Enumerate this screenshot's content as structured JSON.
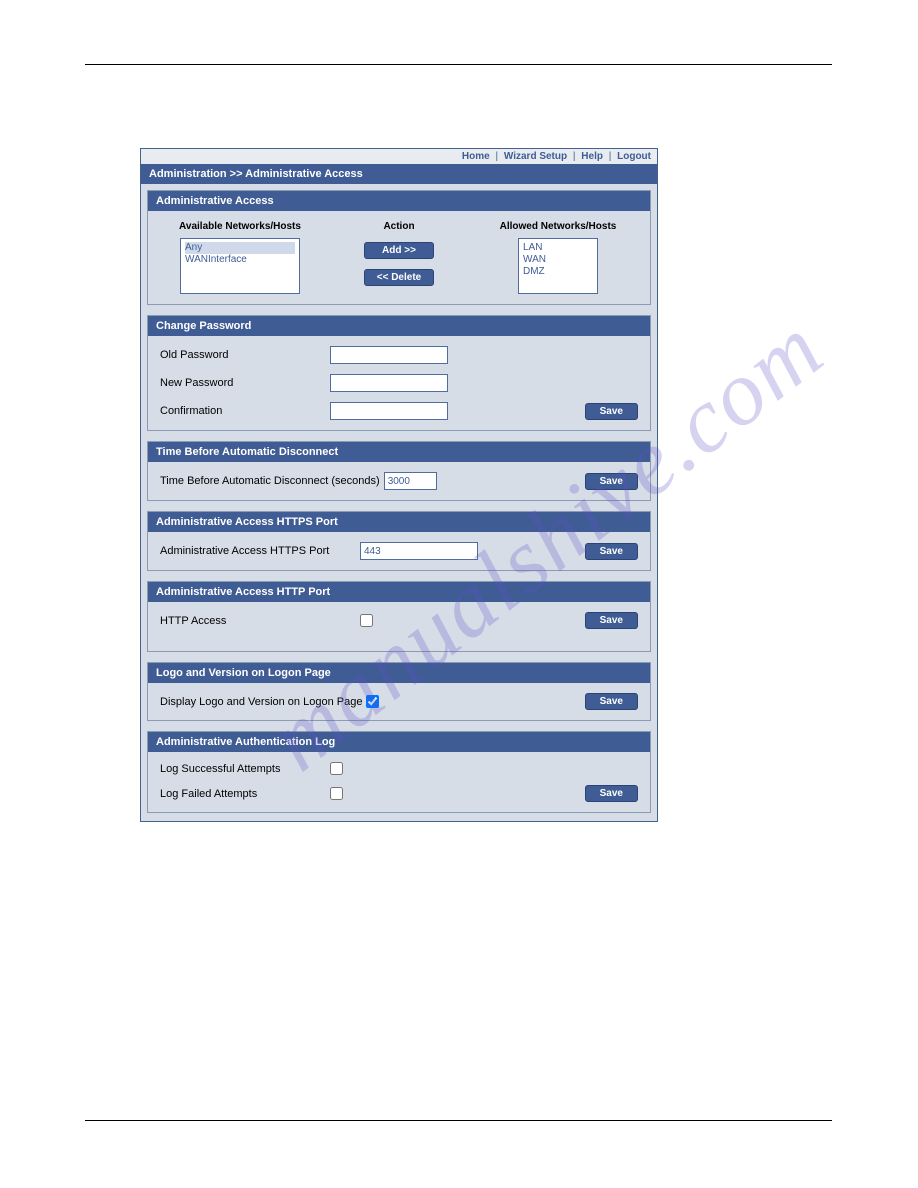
{
  "topnav": {
    "home": "Home",
    "wizard": "Wizard Setup",
    "help": "Help",
    "logout": "Logout",
    "sep": "|"
  },
  "breadcrumb": "Administration >> Administrative Access",
  "panel_admin_access": {
    "title": "Administrative Access",
    "col_available": "Available Networks/Hosts",
    "col_action": "Action",
    "col_allowed": "Allowed Networks/Hosts",
    "available": [
      "Any",
      "WANInterface"
    ],
    "allowed": [
      "LAN",
      "WAN",
      "DMZ"
    ],
    "btn_add": "Add  >>",
    "btn_delete": "<<  Delete"
  },
  "panel_password": {
    "title": "Change Password",
    "old": "Old Password",
    "newp": "New Password",
    "confirm": "Confirmation",
    "save": "Save"
  },
  "panel_timeout": {
    "title": "Time Before Automatic Disconnect",
    "label": "Time Before Automatic Disconnect (seconds)",
    "value": "3000",
    "save": "Save"
  },
  "panel_https": {
    "title": "Administrative Access HTTPS Port",
    "label": "Administrative Access HTTPS Port",
    "value": "443",
    "save": "Save"
  },
  "panel_http": {
    "title": "Administrative Access HTTP Port",
    "label": "HTTP Access",
    "save": "Save"
  },
  "panel_logo": {
    "title": "Logo and Version on Logon Page",
    "label": "Display Logo and Version on Logon Page",
    "save": "Save"
  },
  "panel_authlog": {
    "title": "Administrative Authentication Log",
    "success": "Log Successful Attempts",
    "failed": "Log Failed Attempts",
    "save": "Save"
  }
}
